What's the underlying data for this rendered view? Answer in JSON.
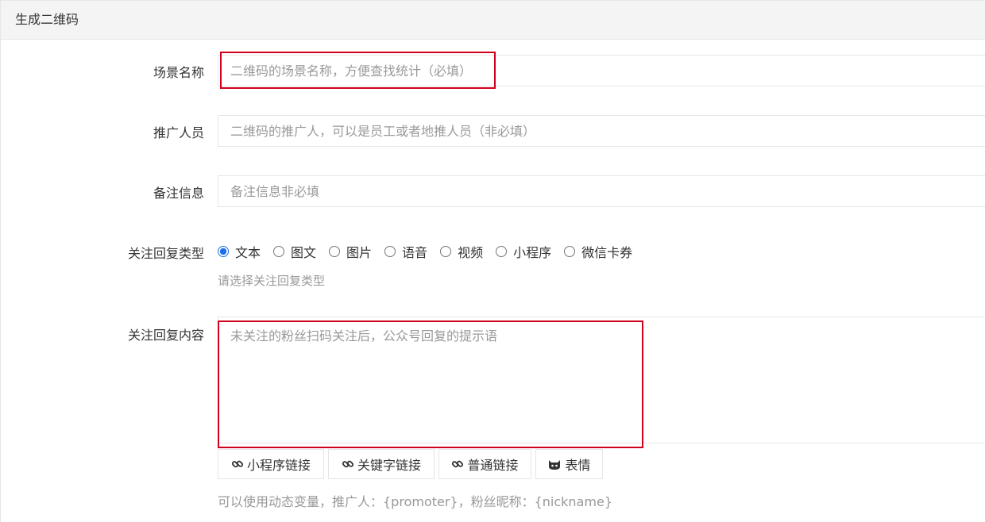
{
  "panel": {
    "title": "生成二维码"
  },
  "fields": {
    "scene_name": {
      "label": "场景名称",
      "placeholder": "二维码的场景名称，方便查找统计（必填）",
      "value": ""
    },
    "promoter": {
      "label": "推广人员",
      "placeholder": "二维码的推广人，可以是员工或者地推人员（非必填）",
      "value": ""
    },
    "remark": {
      "label": "备注信息",
      "placeholder": "备注信息非必填",
      "value": ""
    },
    "reply_type": {
      "label": "关注回复类型",
      "options": [
        "文本",
        "图文",
        "图片",
        "语音",
        "视频",
        "小程序",
        "微信卡券"
      ],
      "selected": "文本",
      "hint": "请选择关注回复类型"
    },
    "reply_content": {
      "label": "关注回复内容",
      "placeholder": "未关注的粉丝扫码关注后，公众号回复的提示语",
      "value": "",
      "buttons": {
        "miniprogram_link": "小程序链接",
        "keyword_link": "关键字链接",
        "normal_link": "普通链接",
        "emoji": "表情"
      },
      "hint": "可以使用动态变量，推广人：{promoter}，粉丝昵称：{nickname}"
    }
  },
  "colors": {
    "highlight": "#d0021b",
    "radio_accent": "#1e6fe8",
    "hint": "#999999",
    "border": "#e6e6e6"
  }
}
